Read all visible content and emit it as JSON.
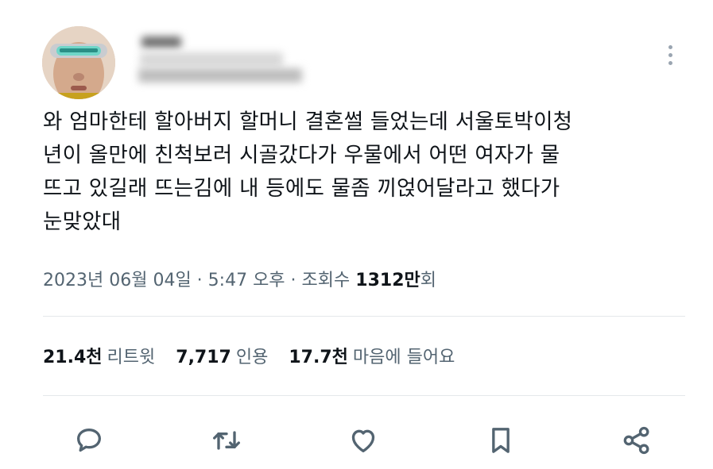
{
  "author": {
    "avatar_icon": "profile-avatar",
    "display_name_redacted": true,
    "handle_redacted": true
  },
  "tweet": {
    "lines": [
      "와 엄마한테 할아버지 할머니 결혼썰 들었는데 서울토박이청",
      "년이 올만에 친척보러 시골갔다가 우물에서 어떤 여자가 물",
      "뜨고 있길래 뜨는김에 내 등에도 물좀 끼얹어달라고 했다가",
      "눈맞았대"
    ]
  },
  "meta": {
    "date": "2023년 06월 04일",
    "sep1": " · ",
    "time": "5:47 오후",
    "sep2": " · ",
    "views_label": "조회수 ",
    "views_num": "1312",
    "views_unit": "만",
    "views_suffix": "회"
  },
  "stats": {
    "retweets": {
      "value": "21.4천",
      "label": "리트윗"
    },
    "quotes": {
      "value": "7,717",
      "label": "인용"
    },
    "likes": {
      "value": "17.7천",
      "label": "마음에 들어요"
    }
  },
  "actions": [
    "reply-icon",
    "retweet-icon",
    "like-icon",
    "bookmark-icon",
    "share-icon"
  ],
  "colors": {
    "secondary_text": "#536471",
    "primary_text": "#0f1419",
    "icon": "#536471",
    "divider": "#e4e8eb"
  }
}
